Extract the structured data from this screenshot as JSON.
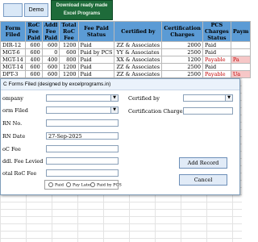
{
  "toolbar": {
    "btn1_label": "",
    "demo_label": "Demo"
  },
  "banner": {
    "line1": "Download ready made",
    "line2": "Excel Programs"
  },
  "grid": {
    "headers": [
      "Form Filed",
      "RoC Fee Paid",
      "Addl Fee Paid",
      "Total RoC Fee",
      "Fee Paid Status",
      "Certified by",
      "Certification Charges",
      "PCS Charges Status",
      "Paym"
    ],
    "rows": [
      [
        "DIR-12",
        "600",
        "600",
        "1200",
        "Paid",
        "ZZ & Associates",
        "2000",
        "Paid",
        ""
      ],
      [
        "MGT-6",
        "600",
        "0",
        "600",
        "Paid by PCS",
        "YY & Associates",
        "2500",
        "Paid",
        ""
      ],
      [
        "MGT-14",
        "400",
        "400",
        "800",
        "Paid",
        "XX & Associates",
        "1200",
        "Payable",
        "Pa"
      ],
      [
        "MGT-14",
        "600",
        "600",
        "1200",
        "Paid",
        "ZZ & Associates",
        "2500",
        "Paid",
        ""
      ],
      [
        "DPT-3",
        "600",
        "600",
        "1200",
        "Paid",
        "ZZ & Associates",
        "2500",
        "Payable",
        "Ua"
      ]
    ]
  },
  "dialog": {
    "title": "C Forms Filed (designed by excelprograms.in)",
    "company_label": "ompany",
    "form_filed_label": "orm Filed",
    "srn_label": "RN No.",
    "srn_date_label": "RN Date",
    "srn_date_value": "27-Sep-2025",
    "roc_fee_label": "oC Fee",
    "addl_fee_label": "ddl. Fee Levied",
    "total_fee_label": "otal RoC Fee",
    "certified_by_label": "Certified by",
    "cert_charges_label": "Certification Charges",
    "radio_paid": "Paid",
    "radio_pay_later": "Pay Later",
    "radio_paid_by_pcs": "Paid by PCS",
    "add_record_label": "Add Record",
    "cancel_label": "Cancel"
  }
}
